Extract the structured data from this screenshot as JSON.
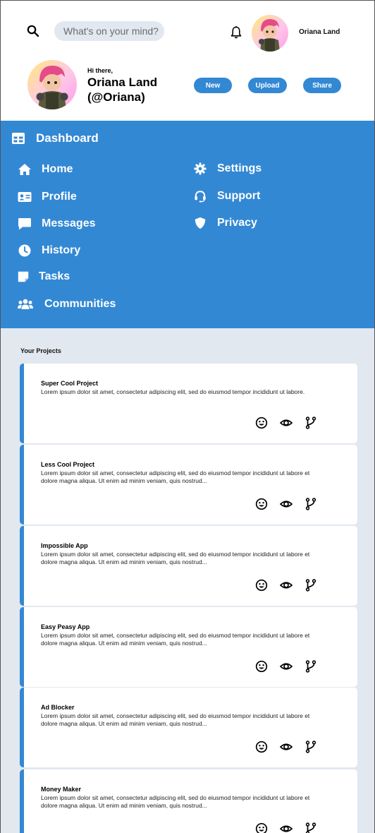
{
  "header": {
    "search_placeholder": "What's on your mind?",
    "user_name": "Oriana Land"
  },
  "profile": {
    "greeting": "Hi there,",
    "display_name": "Oriana Land (@Oriana)"
  },
  "actions": {
    "new_label": "New",
    "upload_label": "Upload",
    "share_label": "Share"
  },
  "nav": {
    "dashboard_label": "Dashboard",
    "items": [
      {
        "label": "Home",
        "icon": "home-icon"
      },
      {
        "label": "Profile",
        "icon": "id-card-icon"
      },
      {
        "label": "Messages",
        "icon": "message-icon"
      },
      {
        "label": "History",
        "icon": "clock-icon"
      },
      {
        "label": "Tasks",
        "icon": "sticky-note-icon"
      },
      {
        "label": "Communities",
        "icon": "users-icon"
      },
      {
        "label": "Settings",
        "icon": "gear-icon"
      },
      {
        "label": "Support",
        "icon": "headset-icon"
      },
      {
        "label": "Privacy",
        "icon": "shield-icon"
      }
    ]
  },
  "projects": {
    "title": "Your Projects",
    "items": [
      {
        "name": "Super Cool Project",
        "description": "Lorem ipsum dolor sit amet, consectetur adipiscing elit, sed do eiusmod tempor incididunt ut labore."
      },
      {
        "name": "Less Cool Project",
        "description": "Lorem ipsum dolor sit amet, consectetur adipiscing elit, sed do eiusmod tempor incididunt ut labore et dolore magna aliqua. Ut enim ad minim veniam, quis nostrud..."
      },
      {
        "name": "Impossible App",
        "description": "Lorem ipsum dolor sit amet, consectetur adipiscing elit, sed do eiusmod tempor incididunt ut labore et dolore magna aliqua. Ut enim ad minim veniam, quis nostrud..."
      },
      {
        "name": "Easy Peasy App",
        "description": "Lorem ipsum dolor sit amet, consectetur adipiscing elit, sed do eiusmod tempor incididunt ut labore et dolore magna aliqua. Ut enim ad minim veniam, quis nostrud..."
      },
      {
        "name": "Ad Blocker",
        "description": "Lorem ipsum dolor sit amet, consectetur adipiscing elit, sed do eiusmod tempor incididunt ut labore et dolore magna aliqua. Ut enim ad minim veniam, quis nostrud..."
      },
      {
        "name": "Money Maker",
        "description": "Lorem ipsum dolor sit amet, consectetur adipiscing elit, sed do eiusmod tempor incididunt ut labore et dolore magna aliqua. Ut enim ad minim veniam, quis nostrud..."
      }
    ]
  },
  "colors": {
    "accent": "#3388d4",
    "page_background": "#e2e8f0"
  }
}
